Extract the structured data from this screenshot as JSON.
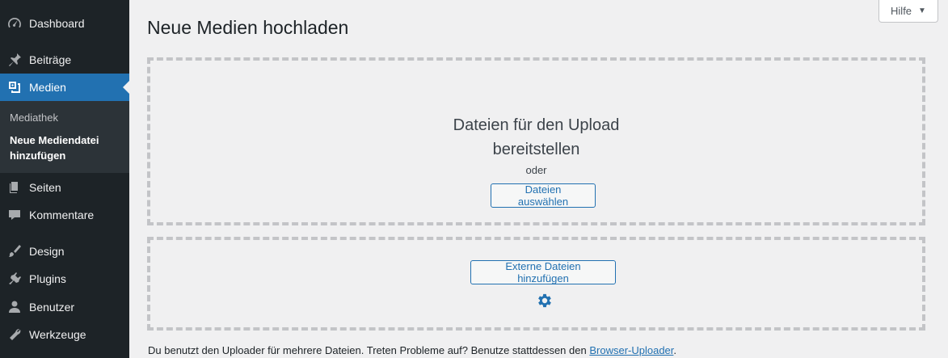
{
  "sidebar": {
    "items": [
      {
        "label": "Dashboard",
        "icon": "dashboard-icon"
      },
      {
        "label": "Beiträge",
        "icon": "pin-icon"
      },
      {
        "label": "Medien",
        "icon": "media-icon",
        "active": true
      },
      {
        "label": "Seiten",
        "icon": "pages-icon"
      },
      {
        "label": "Kommentare",
        "icon": "comment-icon"
      },
      {
        "label": "Design",
        "icon": "brush-icon"
      },
      {
        "label": "Plugins",
        "icon": "plugin-icon"
      },
      {
        "label": "Benutzer",
        "icon": "user-icon"
      },
      {
        "label": "Werkzeuge",
        "icon": "wrench-icon"
      }
    ],
    "submenu": [
      {
        "label": "Mediathek"
      },
      {
        "label": "Neue Mediendatei hinzufügen",
        "current": true
      }
    ]
  },
  "header": {
    "help_label": "Hilfe",
    "title": "Neue Medien hochladen"
  },
  "upload": {
    "drop_line1": "Dateien für den Upload",
    "drop_line2": "bereitstellen",
    "or_text": "oder",
    "select_files_label": "Dateien auswählen",
    "add_external_label": "Externe Dateien hinzufügen",
    "note_text": "Du benutzt den Uploader für mehrere Dateien. Treten Probleme auf? Benutze stattdessen den ",
    "note_link": "Browser-Uploader",
    "note_end": "."
  },
  "colors": {
    "sidebar_bg": "#1d2327",
    "accent": "#2271b1",
    "page_bg": "#f0f0f1"
  }
}
